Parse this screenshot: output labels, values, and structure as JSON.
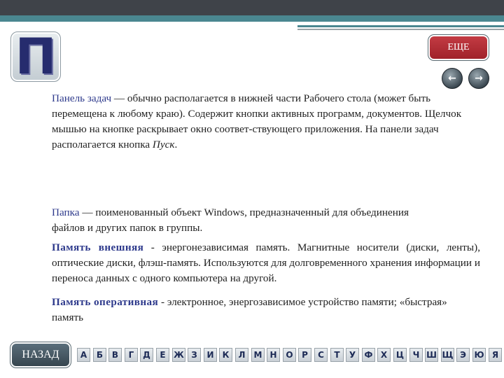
{
  "header": {
    "letter": "П",
    "more_label": "ЕЩЕ",
    "prev_icon": "left-circle-arrow-icon",
    "next_icon": "right-circle-arrow-icon"
  },
  "entries": [
    {
      "term": "Панель задач",
      "text": " — обычно располагается в нижней части Рабочего стола (может быть перемещена к любому краю). Содержит кнопки активных программ, документов. Щелчок мышью на кнопке раскрывает окно соответ-ствующего приложения. На панели задач располагается кнопка ",
      "emphasis": "Пуск",
      "tail": "."
    },
    {
      "term": "Папка",
      "text": " — поименованный объект  Windows, предназначенный для объединения файлов и других папок в группы."
    },
    {
      "term": "Память внешняя",
      "text": " - энергонезависимая память. Магнитные носители (диски, ленты), оптические диски, флэш-память. Используются для долговременного хранения информации и переноса данных   с одного компьютера на другой."
    },
    {
      "term": "Память оперативная",
      "text": " - электронное, энергозависимое  устройство памяти; «быстрая» память"
    }
  ],
  "footer": {
    "back_label": "НАЗАД",
    "letters": [
      "А",
      "Б",
      "В",
      "Г",
      "Д",
      "Е",
      "Ж",
      "З",
      "И",
      "К",
      "Л",
      "М",
      "Н",
      "О",
      "Р",
      "С",
      "Т",
      "У",
      "Ф",
      "Х",
      "Ц",
      "Ч",
      "Ш",
      "Щ",
      "Э",
      "Ю",
      "Я"
    ]
  },
  "colors": {
    "accent_red": "#b0303a",
    "term_blue": "#2e3a8c",
    "teal_bar": "#4a8790",
    "dark_bar": "#3f4349"
  }
}
